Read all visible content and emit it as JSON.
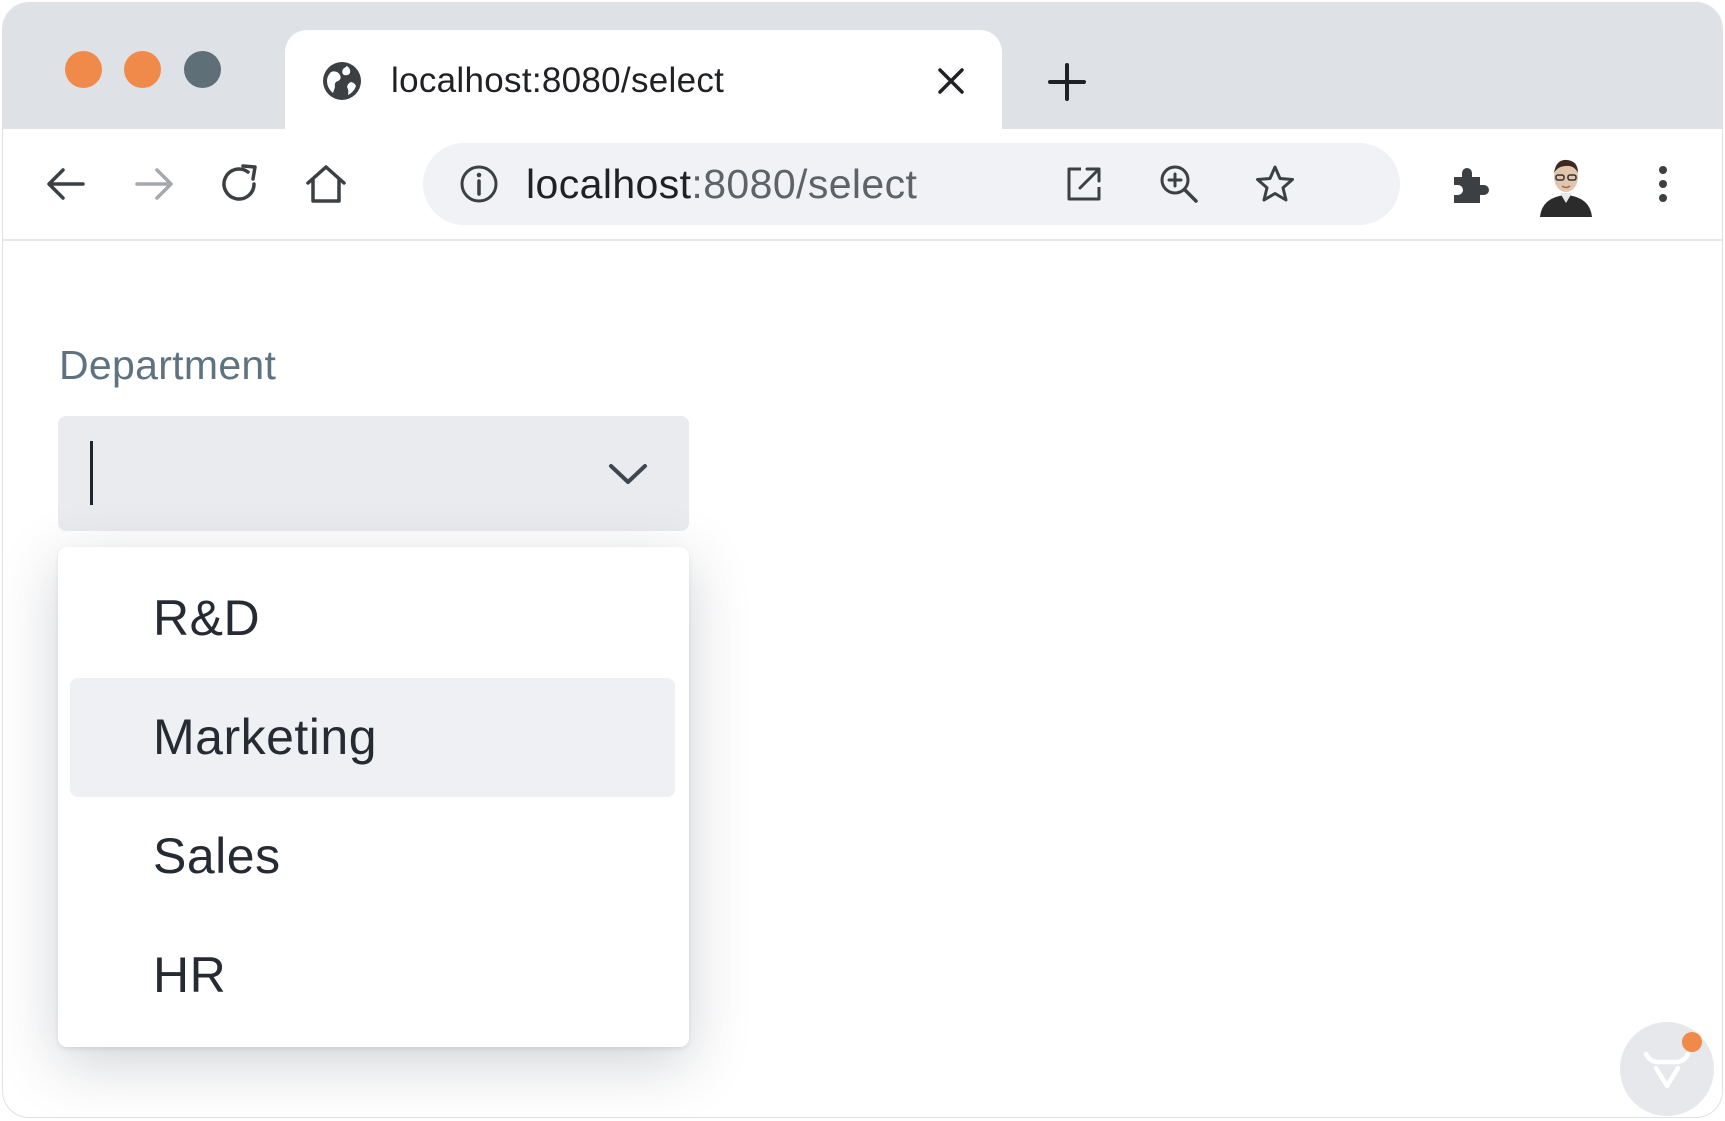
{
  "browser": {
    "tab": {
      "title": "localhost:8080/select",
      "favicon": "globe-icon"
    },
    "toolbar": {
      "icons": [
        "back-arrow-icon",
        "forward-arrow-icon",
        "reload-icon",
        "home-icon"
      ],
      "address_bar": {
        "host": "localhost",
        "path": ":8080/select",
        "icons": [
          "info-icon",
          "open-external-icon",
          "zoom-icon",
          "bookmark-star-icon"
        ]
      },
      "right_icons": [
        "extensions-puzzle-icon",
        "profile-avatar",
        "menu-dots-icon"
      ]
    }
  },
  "form": {
    "department": {
      "label": "Department",
      "value": "",
      "toggle_icon": "chevron-down-icon",
      "options": [
        "R&D",
        "Marketing",
        "Sales",
        "HR"
      ],
      "hovered_option": "Marketing"
    }
  },
  "colors": {
    "tab_strip": "#dee1e6",
    "field_background": "#e9ebee",
    "hover_background": "#eef0f3",
    "accent_orange": "#f08a4b",
    "label": "#5e7280"
  },
  "dev_badge": {
    "icon": "vaadin-logo-icon"
  }
}
